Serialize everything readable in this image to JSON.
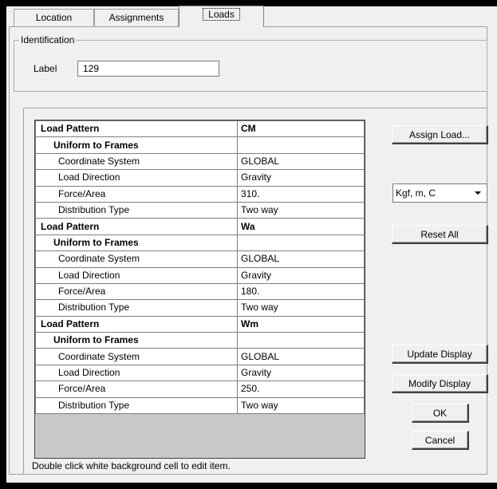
{
  "tabs": [
    {
      "label": "Location"
    },
    {
      "label": "Assignments"
    },
    {
      "label": "Loads",
      "active": true
    }
  ],
  "identification": {
    "group_title": "Identification",
    "label_caption": "Label",
    "label_value": "129"
  },
  "grid": {
    "rows": [
      {
        "type": "pattern",
        "name": "Load Pattern",
        "value": "CM"
      },
      {
        "type": "section",
        "name": "Uniform to Frames",
        "value": ""
      },
      {
        "type": "prop",
        "name": "Coordinate System",
        "value": "GLOBAL"
      },
      {
        "type": "prop",
        "name": "Load Direction",
        "value": "Gravity"
      },
      {
        "type": "prop",
        "name": "Force/Area",
        "value": "310."
      },
      {
        "type": "prop",
        "name": "Distribution Type",
        "value": "Two way"
      },
      {
        "type": "pattern",
        "name": "Load Pattern",
        "value": "Wa"
      },
      {
        "type": "section",
        "name": "Uniform to Frames",
        "value": ""
      },
      {
        "type": "prop",
        "name": "Coordinate System",
        "value": "GLOBAL"
      },
      {
        "type": "prop",
        "name": "Load Direction",
        "value": "Gravity"
      },
      {
        "type": "prop",
        "name": "Force/Area",
        "value": "180."
      },
      {
        "type": "prop",
        "name": "Distribution Type",
        "value": "Two way"
      },
      {
        "type": "pattern",
        "name": "Load Pattern",
        "value": "Wm"
      },
      {
        "type": "section",
        "name": "Uniform to Frames",
        "value": ""
      },
      {
        "type": "prop",
        "name": "Coordinate System",
        "value": "GLOBAL"
      },
      {
        "type": "prop",
        "name": "Load Direction",
        "value": "Gravity"
      },
      {
        "type": "prop",
        "name": "Force/Area",
        "value": "250."
      },
      {
        "type": "prop",
        "name": "Distribution Type",
        "value": "Two way"
      }
    ]
  },
  "hint": "Double click white background cell to edit item.",
  "buttons": {
    "assign_load": "Assign Load...",
    "reset_all": "Reset All",
    "update_display": "Update Display",
    "modify_display": "Modify Display",
    "ok": "OK",
    "cancel": "Cancel"
  },
  "units_select": {
    "value": "Kgf, m, C",
    "icon": "chevron-down-icon"
  }
}
